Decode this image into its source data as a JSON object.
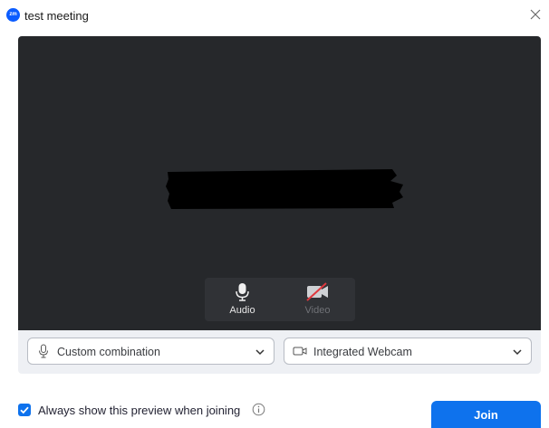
{
  "window": {
    "logo_text": "zm",
    "title": "test meeting"
  },
  "preview": {
    "controls": {
      "audio_label": "Audio",
      "video_label": "Video"
    }
  },
  "devices": {
    "audio": {
      "icon": "microphone-icon",
      "value": "Custom combination"
    },
    "video": {
      "icon": "camera-icon",
      "value": "Integrated Webcam"
    }
  },
  "footer": {
    "always_show_label": "Always show this preview when joining",
    "always_show_checked": true,
    "join_label": "Join"
  },
  "colors": {
    "accent": "#0e72ed",
    "preview_bg": "#26282b",
    "control_bg": "#303236"
  }
}
